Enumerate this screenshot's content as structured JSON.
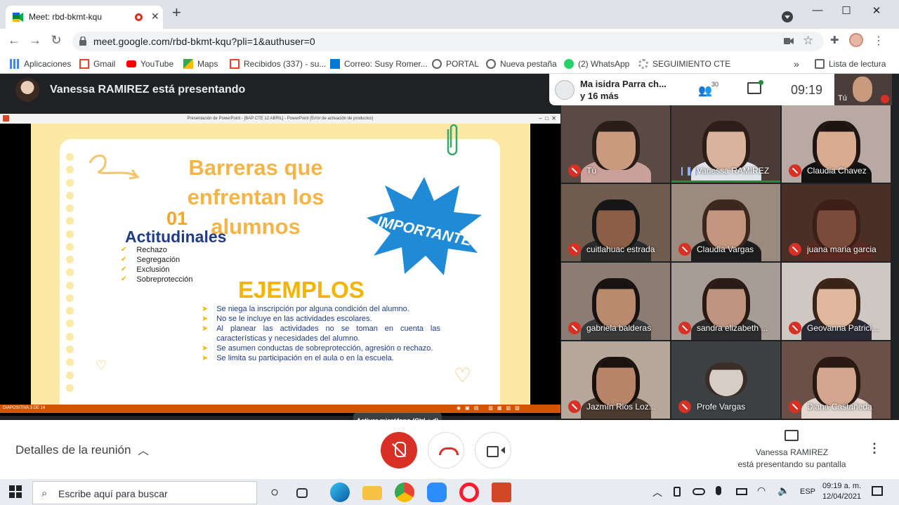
{
  "browser": {
    "tab_title": "Meet: rbd-bkmt-kqu",
    "url": "meet.google.com/rbd-bkmt-kqu?pli=1&authuser=0",
    "new_tab_label": "+",
    "close_tab_label": "✕",
    "window_controls": [
      "—",
      "☐",
      "✕"
    ]
  },
  "bookmarks": [
    {
      "label": "Aplicaciones",
      "icon": "apps-grid-icon",
      "color": "#4285f4"
    },
    {
      "label": "Gmail",
      "icon": "gmail-icon",
      "color": "#ea4335"
    },
    {
      "label": "YouTube",
      "icon": "youtube-icon",
      "color": "#ff0000"
    },
    {
      "label": "Maps",
      "icon": "maps-icon",
      "color": "#34a853"
    },
    {
      "label": "Recibidos (337) - su...",
      "icon": "gmail-icon",
      "color": "#ea4335"
    },
    {
      "label": "Correo: Susy Romer...",
      "icon": "outlook-icon",
      "color": "#0078d4"
    },
    {
      "label": "PORTAL",
      "icon": "globe-icon",
      "color": "#5f6368"
    },
    {
      "label": "Nueva pestaña",
      "icon": "globe-icon",
      "color": "#5f6368"
    },
    {
      "label": "(2) WhatsApp",
      "icon": "whatsapp-icon",
      "color": "#25d366"
    },
    {
      "label": "SEGUIMIENTO CTE",
      "icon": "gear-icon",
      "color": "#9aa0a6"
    }
  ],
  "bookmarks_overflow": "»",
  "reading_list": "Lista de lectura",
  "meet": {
    "presenter_banner": "Vanessa RAMIREZ está presentando",
    "participants_pill": "Ma isidra Parra ch...\ny 16 más",
    "people_count": "30",
    "clock": "09:19",
    "self_label": "Tú",
    "tiles": [
      {
        "name": "Tú",
        "muted": true,
        "bg": "#5a4a44",
        "skin": "#c99a7e",
        "hair": "#2a1c16",
        "shirt": "#c9a19a"
      },
      {
        "name": "Vanessa RAMIREZ",
        "muted": false,
        "speaking": true,
        "bg": "#4b3b36",
        "skin": "#d9b39c",
        "hair": "#2c1d17",
        "shirt": "#dfe4ea"
      },
      {
        "name": "Claudia Chavez",
        "muted": true,
        "bg": "#b9a9a4",
        "skin": "#d9ab91",
        "hair": "#1f1410",
        "shirt": "#121212"
      },
      {
        "name": "cuitlahuac estrada",
        "muted": true,
        "bg": "#6f5c4e",
        "skin": "#8b5e45",
        "hair": "#161616",
        "shirt": "#2b2b2b"
      },
      {
        "name": "Claudia Vargas",
        "muted": true,
        "bg": "#9a8a7f",
        "skin": "#c4967e",
        "hair": "#3b271d",
        "shirt": "#1d1d1d"
      },
      {
        "name": "juana maria garcia",
        "muted": true,
        "bg": "#4a2e28",
        "skin": "#7a4a3a",
        "hair": "#3b1f18",
        "shirt": "#5a2a22"
      },
      {
        "name": "gabriela balderas",
        "muted": true,
        "bg": "#8c7d74",
        "skin": "#b98a6e",
        "hair": "#1a1210",
        "shirt": "#3a3a3a"
      },
      {
        "name": "sandra elizabeth ...",
        "muted": true,
        "bg": "#a79d96",
        "skin": "#bf9580",
        "hair": "#2a1a14",
        "shirt": "#2d2d2d"
      },
      {
        "name": "Geovanna Patrici...",
        "muted": true,
        "bg": "#cfc7c2",
        "skin": "#e0b89e",
        "hair": "#3a2418",
        "shirt": "#2a2a36"
      },
      {
        "name": "Jazmín Rios Loz...",
        "muted": true,
        "bg": "#b7a89c",
        "skin": "#b8856a",
        "hair": "#1b110d",
        "shirt": "#4a3a30"
      },
      {
        "name": "Profe Vargas",
        "muted": true,
        "bg": "#3c4043",
        "skin": "#d8cdc6",
        "hair": "#3a2d28",
        "shirt": "#3c4043",
        "avatar": true
      },
      {
        "name": "Diana Castañeda",
        "muted": true,
        "bg": "#6b5048",
        "skin": "#d3a78e",
        "hair": "#2a1813",
        "shirt": "#e3d7d0"
      }
    ],
    "tooltip": "Activar micrófono (Ctrl + d)",
    "details_label": "Detalles de la reunión",
    "presenting_text": "Vanessa RAMIREZ\nestá presentando su pantalla"
  },
  "ppt": {
    "window_title": "Presentación de PowerPoint - [BAP CTE 12 ABRIL] - PowerPoint (Error de activación de productos)",
    "status": "DIAPOSITIVA 3 DE 14",
    "slide": {
      "title": "Barreras que enfrentan los alumnos",
      "number": "01",
      "heading": "Actitudinales",
      "attitudes": [
        "Rechazo",
        "Segregación",
        "Exclusión",
        "Sobreprotección"
      ],
      "badge": "IMPORTANTE",
      "examples_title": "EJEMPLOS",
      "examples": [
        "Se niega la inscripción por alguna condición del alumno.",
        "No se le incluye en las actividades escolares.",
        "Al planear las actividades no se toman en cuenta las características y necesidades del alumno.",
        "Se asumen conductas de sobreprotección, agresión o rechazo.",
        "Se limita su participación en el aula o en la escuela."
      ]
    }
  },
  "taskbar": {
    "search_placeholder": "Escribe aquí para buscar",
    "lang": "ESP",
    "time": "09:19 a. m.",
    "date": "12/04/2021",
    "apps": [
      "task-view-icon",
      "edge-icon",
      "file-explorer-icon",
      "chrome-icon",
      "zoom-icon",
      "opera-icon",
      "powerpoint-icon"
    ]
  }
}
